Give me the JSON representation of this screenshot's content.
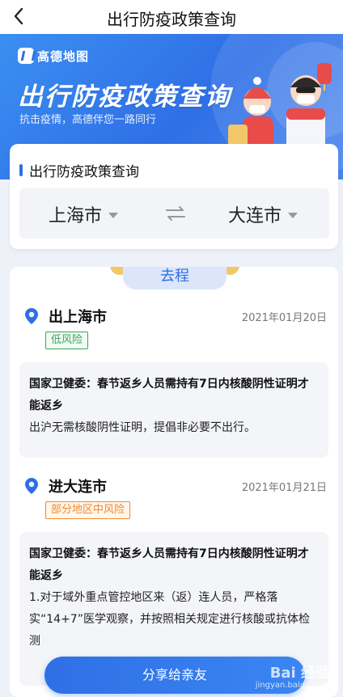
{
  "nav": {
    "title": "出行防疫政策查询",
    "back_icon": "back-arrow-icon"
  },
  "banner": {
    "logo_text": "高德地图",
    "title": "出行防疫政策查询",
    "subtitle": "抗击疫情，高德伴您一路同行"
  },
  "search": {
    "title": "出行防疫政策查询",
    "from_city": "上海市",
    "to_city": "大连市",
    "swap_icon": "swap-icon"
  },
  "tab": {
    "label": "去程"
  },
  "departure": {
    "city": "出上海市",
    "date": "2021年01月20日",
    "risk": "低风险",
    "notice_title": "国家卫健委：春节返乡人员需持有7日内核酸阴性证明才能返乡",
    "notice_body": "出沪无需核酸阴性证明，提倡非必要不出行。"
  },
  "arrival": {
    "city": "进大连市",
    "date": "2021年01月21日",
    "risk": "部分地区中风险",
    "notice_title": "国家卫健委：春节返乡人员需持有7日内核酸阴性证明才能返乡",
    "notice_body": "1.对于域外重点管控地区来（返）连人员，严格落实“14+7”医学观察，并按照相关规定进行核酸或抗体检测"
  },
  "share": {
    "label": "分享给亲友"
  },
  "watermark": {
    "text": "Bai 经验",
    "url": "jingyan.baidu.com"
  },
  "colors": {
    "primary": "#2f6fe6",
    "low_risk": "#3aa55b",
    "mid_risk": "#f08a2a"
  }
}
